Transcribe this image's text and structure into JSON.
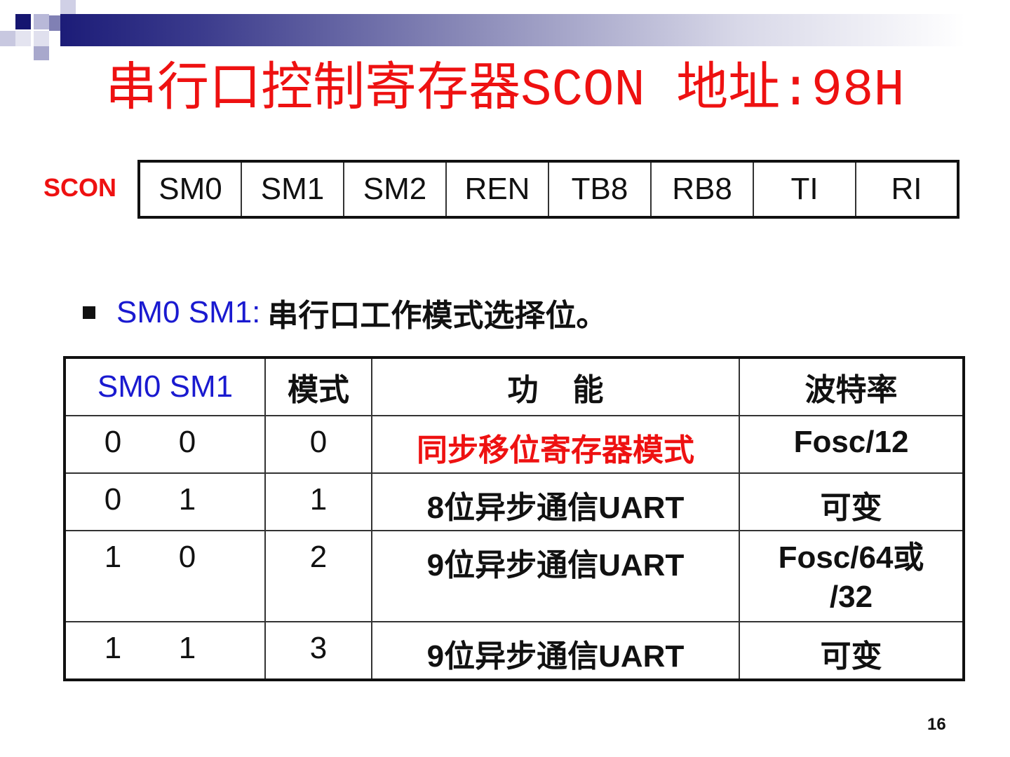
{
  "slide": {
    "title": "串行口控制寄存器SCON 地址:98H",
    "page_number": "16"
  },
  "register": {
    "label": "SCON",
    "bits": [
      "SM0",
      "SM1",
      "SM2",
      "REN",
      "TB8",
      "RB8",
      "TI",
      "RI"
    ]
  },
  "bullet": {
    "blue_text": "SM0 SM1:",
    "black_text": "串行口工作模式选择位。"
  },
  "modes_table": {
    "headers": [
      "SM0  SM1",
      "模式",
      "功    能",
      "波特率"
    ],
    "rows": [
      {
        "sm0": "0",
        "sm1": "0",
        "mode": "0",
        "function": "同步移位寄存器模式",
        "baud": "Fosc/12"
      },
      {
        "sm0": "0",
        "sm1": "1",
        "mode": "1",
        "function": "8位异步通信UART",
        "baud": "可变"
      },
      {
        "sm0": "1",
        "sm1": "0",
        "mode": "2",
        "function": "9位异步通信UART",
        "baud": "Fosc/64或",
        "baud_line2": "/32"
      },
      {
        "sm0": "1",
        "sm1": "1",
        "mode": "3",
        "function": "9位异步通信UART",
        "baud": "可变"
      }
    ]
  },
  "colors": {
    "title": "#ee1111",
    "blue_text": "#1a1ad0",
    "band_dark": "#1c1c78"
  }
}
